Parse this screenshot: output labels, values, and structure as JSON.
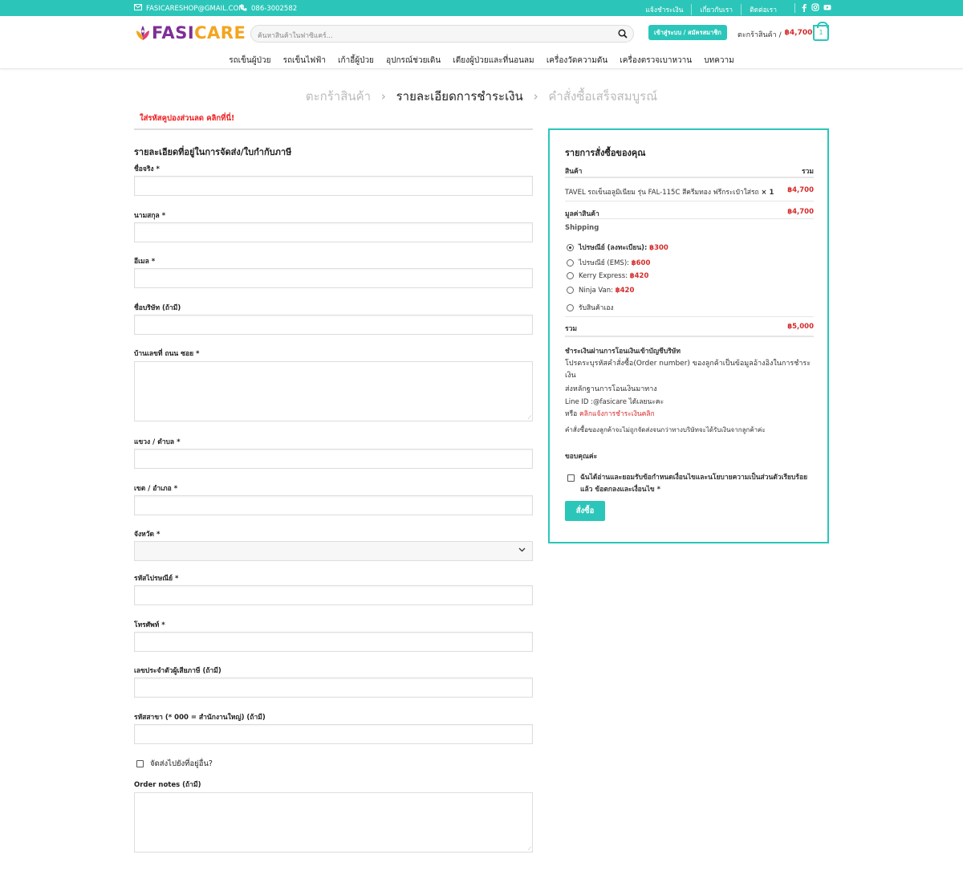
{
  "colors": {
    "accent": "#2bc6b9",
    "price": "#d52a2a",
    "coupon": "#e22222",
    "brand_purple": "#7e2f96",
    "brand_orange": "#f3a51e"
  },
  "topbar": {
    "email": "FASICARESHOP@GMAIL.COM",
    "phone": "086-3002582",
    "links": [
      "แจ้งชำระเงิน",
      "เกี่ยวกับเรา",
      "ติดต่อเรา"
    ],
    "social_icons": [
      "facebook-icon",
      "instagram-icon",
      "youtube-icon"
    ]
  },
  "header": {
    "logo_part1": "FASI",
    "logo_part2": "CARE",
    "search_placeholder": "ค้นหาสินค้าในฟาซิแคร์...",
    "login_label": "เข้าสู่ระบบ / สมัครสมาชิก",
    "cart_label": "ตะกร้าสินค้า /",
    "cart_amount": "฿4,700",
    "cart_count": "1"
  },
  "nav": [
    "รถเข็นผู้ป่วย",
    "รถเข็นไฟฟ้า",
    "เก้าอี้ผู้ป่วย",
    "อุปกรณ์ช่วยเดิน",
    "เตียงผู้ป่วยและที่นอนลม",
    "เครื่องวัดความดัน",
    "เครื่องตรวจเบาหวาน",
    "บทความ"
  ],
  "steps": {
    "cart": "ตะกร้าสินค้า",
    "checkout": "รายละเอียดการชำระเงิน",
    "complete": "คำสั่งซื้อเสร็จสมบูรณ์"
  },
  "coupon_text": "ใส่รหัสคูปองส่วนลด คลิกที่นี่!",
  "form": {
    "title": "รายละเอียดที่อยู่ในการจัดส่ง/ใบกำกับภาษี",
    "fields": {
      "first_name": "ชื่อจริง *",
      "last_name": "นามสกุล *",
      "email": "อีเมล *",
      "company": "ชื่อบริษัท (ถ้ามี)",
      "address": "บ้านเลขที่ ถนน ซอย *",
      "subdistrict": "แขวง / ตำบล *",
      "district": "เขต / อำเภอ *",
      "province": "จังหวัด *",
      "postcode": "รหัสไปรษณีย์ *",
      "phone": "โทรศัพท์ *",
      "tax_id": "เลขประจำตัวผู้เสียภาษี (ถ้ามี)",
      "branch": "รหัสสาขา (* 000 = สำนักงานใหญ่) (ถ้ามี)",
      "order_notes": "Order notes (ถ้ามี)"
    },
    "ship_other": "จัดส่งไปยังที่อยู่อื่น?"
  },
  "order": {
    "title": "รายการสั่งซื้อของคุณ",
    "col_product": "สินค้า",
    "col_total": "รวม",
    "item_name": "TAVEL รถเข็นอลูมิเนียม รุ่น FAL-115C สีครีมทอง ฟรีกระเป๋าใส่รถ",
    "item_qty": "× 1",
    "item_price": "฿4,700",
    "subtotal_label": "มูลค่าสินค้า",
    "subtotal": "฿4,700",
    "shipping_label": "Shipping",
    "shipping_options": [
      {
        "label": "ไปรษณีย์ (ลงทะเบียน):",
        "price": "฿300",
        "selected": true
      },
      {
        "label": "ไปรษณีย์ (EMS):",
        "price": "฿600",
        "selected": false
      },
      {
        "label": "Kerry Express:",
        "price": "฿420",
        "selected": false
      },
      {
        "label": "Ninja Van:",
        "price": "฿420",
        "selected": false
      },
      {
        "label": "รับสินค้าเอง",
        "price": "",
        "selected": false
      }
    ],
    "total_label": "รวม",
    "total": "฿5,000",
    "payment_title": "ชำระเงินผ่านการโอนเงินเข้าบัญชีบริษัท",
    "payment_line1": "โปรดระบุรหัสคำสั่งซื้อ(Order number) ของลูกค้าเป็นข้อมูลอ้างอิงในการชำระเงิน",
    "payment_line2": "ส่งหลักฐานการโอนเงินมาทาง",
    "payment_line3": "Line ID :@fasicare ได้เลยนะคะ",
    "payment_line4_prefix": "หรือ",
    "payment_line4_link": "คลิกแจ้งการชำระเงินคลิก",
    "payment_note": "คำสั่งซื้อของลูกค้าจะไม่ถูกจัดส่งจนกว่าทางบริษัทจะได้รับเงินจากลูกค้าค่ะ",
    "thanks": "ขอบคุณค่ะ",
    "terms": "ฉันได้อ่านและยอมรับข้อกำหนดเงื่อนไขและนโยบายความเป็นส่วนตัวเรียบร้อยแล้ว ข้อตกลงและเงื่อนไข *",
    "place_order": "สั่งซื้อ"
  }
}
